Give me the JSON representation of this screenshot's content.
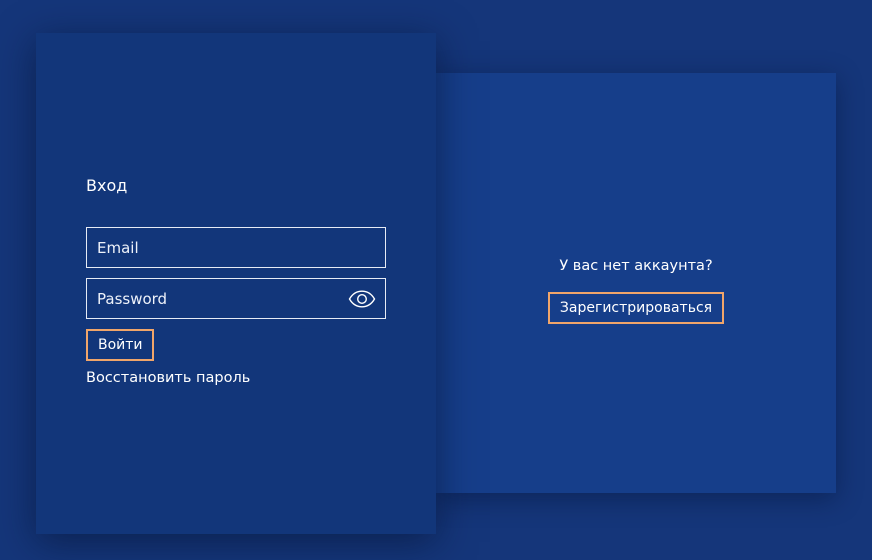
{
  "login": {
    "title": "Вход",
    "email_placeholder": "Email",
    "password_placeholder": "Password",
    "login_button": "Войти",
    "forgot_password": "Восстановить пароль"
  },
  "signup": {
    "question": "У вас нет аккаунта?",
    "register_button": "Зарегистрироваться"
  },
  "colors": {
    "background": "#15367a",
    "login_panel": "#12367a",
    "signup_panel": "#163e8a",
    "accent_border": "#f0a56a"
  },
  "icons": {
    "password_toggle": "eye-icon"
  }
}
